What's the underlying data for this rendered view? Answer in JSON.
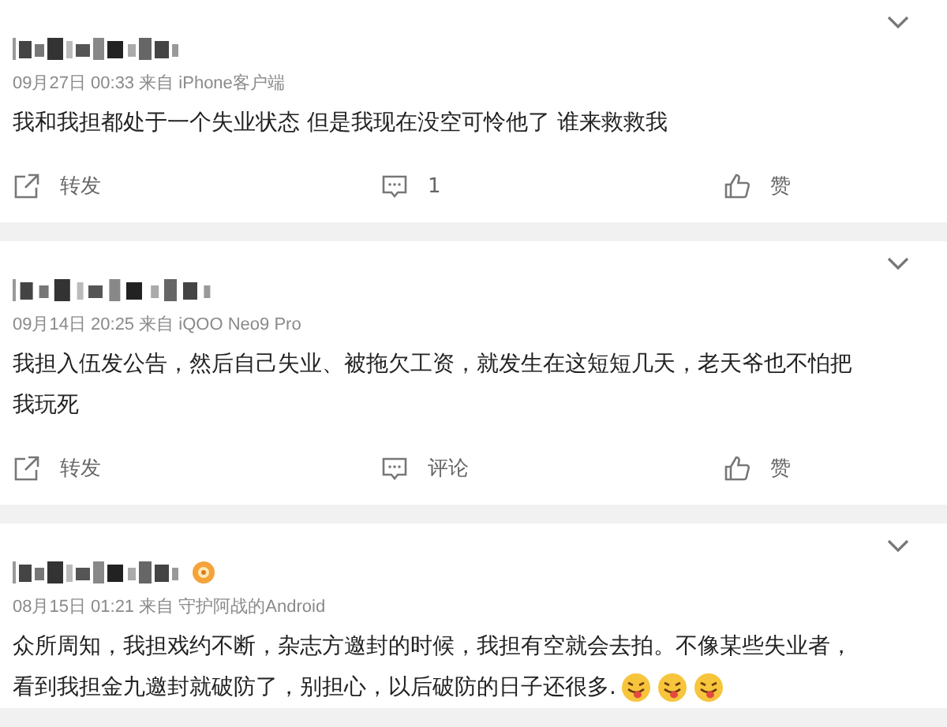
{
  "posts": [
    {
      "meta": "09月27日 00:33  来自 iPhone客户端",
      "lines": [
        "我和我担都处于一个失业状态 但是我现在没空可怜他了 谁来救救我"
      ],
      "actions": {
        "repost": "转发",
        "comment": "1",
        "like": "赞"
      }
    },
    {
      "meta": "09月14日 20:25  来自 iQOO Neo9 Pro",
      "lines": [
        "我担入伍发公告，然后自己失业、被拖欠工资，就发生在这短短几天，老天爷也不怕把",
        "我玩死"
      ],
      "actions": {
        "repost": "转发",
        "comment": "评论",
        "like": "赞"
      }
    },
    {
      "meta": "08月15日 01:21  来自 守护阿战的Android",
      "badge": {
        "kind": "medal"
      },
      "lines": [
        "众所周知，我担戏约不断，杂志方邀封的时候，我担有空就会去拍。不像某些失业者，",
        "看到我担金九邀封就破防了，别担心，以后破防的日子还很多."
      ],
      "emojis": [
        {
          "kind": "tongue"
        },
        {
          "kind": "tongue"
        },
        {
          "kind": "tongue"
        }
      ]
    }
  ]
}
